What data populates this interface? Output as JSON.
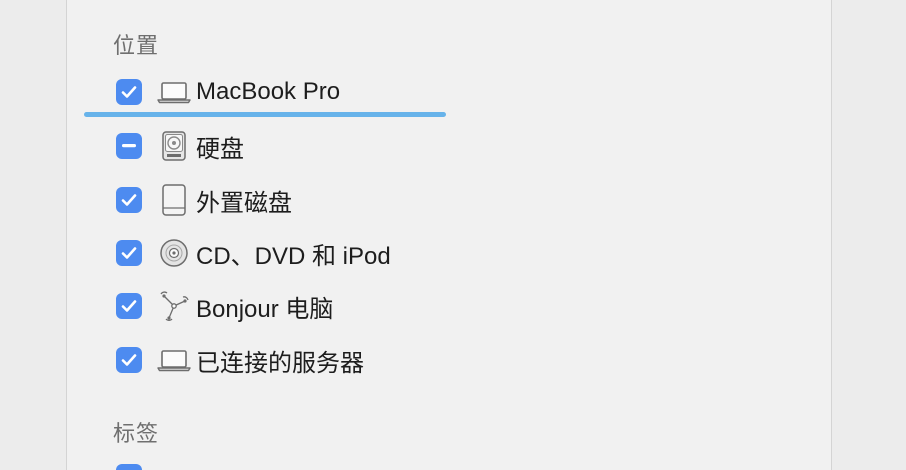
{
  "sections": {
    "locations": {
      "title": "位置",
      "items": [
        {
          "label": "MacBook Pro",
          "state": "checked",
          "icon": "laptop-icon"
        },
        {
          "label": "硬盘",
          "state": "mixed",
          "icon": "hard-drive-icon"
        },
        {
          "label": "外置磁盘",
          "state": "checked",
          "icon": "external-disk-icon"
        },
        {
          "label": "CD、DVD 和 iPod",
          "state": "checked",
          "icon": "cd-icon"
        },
        {
          "label": "Bonjour 电脑",
          "state": "checked",
          "icon": "bonjour-icon"
        },
        {
          "label": "已连接的服务器",
          "state": "checked",
          "icon": "server-icon"
        }
      ]
    },
    "tags": {
      "title": "标签"
    }
  },
  "colors": {
    "checkbox": "#4d8bf0",
    "highlight_underline": "#67b3ea"
  }
}
